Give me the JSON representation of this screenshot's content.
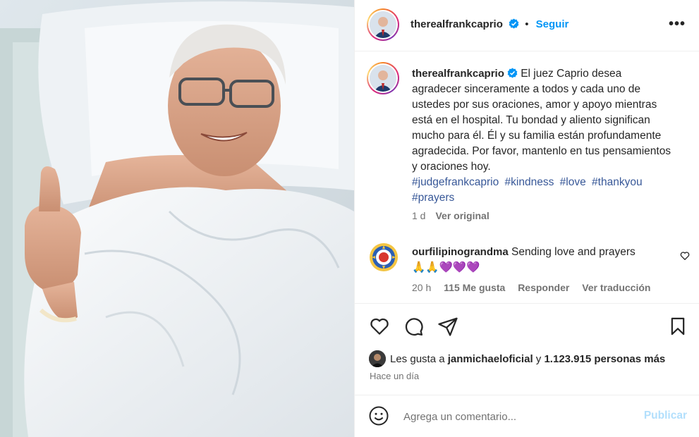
{
  "post": {
    "author": "therealfrankcaprio",
    "follow_label": "Seguir",
    "separator": "•",
    "more_label": "•••"
  },
  "caption": {
    "author": "therealfrankcaprio",
    "text": "El juez Caprio desea agradecer sinceramente a todos y cada uno de ustedes por sus oraciones, amor y apoyo mientras está en el hospital. Tu bondad y aliento significan mucho para él. Él y su familia están profundamente agradecida. Por favor, mantenlo en tus pensamientos y oraciones hoy.",
    "hashtags": [
      "#judgefrankcaprio",
      "#kindness",
      "#love",
      "#thankyou",
      "#prayers"
    ],
    "time": "1 d",
    "see_original": "Ver original"
  },
  "comment": {
    "author": "ourfilipinograndma",
    "text": "Sending love and prayers",
    "emojis": "🙏🙏💜💜💜",
    "time": "20 h",
    "likes": "115 Me gusta",
    "reply": "Responder",
    "translate": "Ver traducción"
  },
  "likes": {
    "prefix": "Les gusta a",
    "user": "janmichaeloficial",
    "middle": "y",
    "count": "1.123.915 personas más"
  },
  "posted_ago": "Hace un día",
  "composer": {
    "placeholder": "Agrega un comentario...",
    "publish_label": "Publicar"
  },
  "colors": {
    "accent": "#0095f6",
    "hashtag": "#385898",
    "muted": "#737373",
    "publish_disabled": "#b2dffc"
  },
  "icons": [
    "verified-badge-icon",
    "more-options-icon",
    "heart-icon",
    "comment-icon",
    "share-icon",
    "bookmark-icon",
    "emoji-icon"
  ]
}
